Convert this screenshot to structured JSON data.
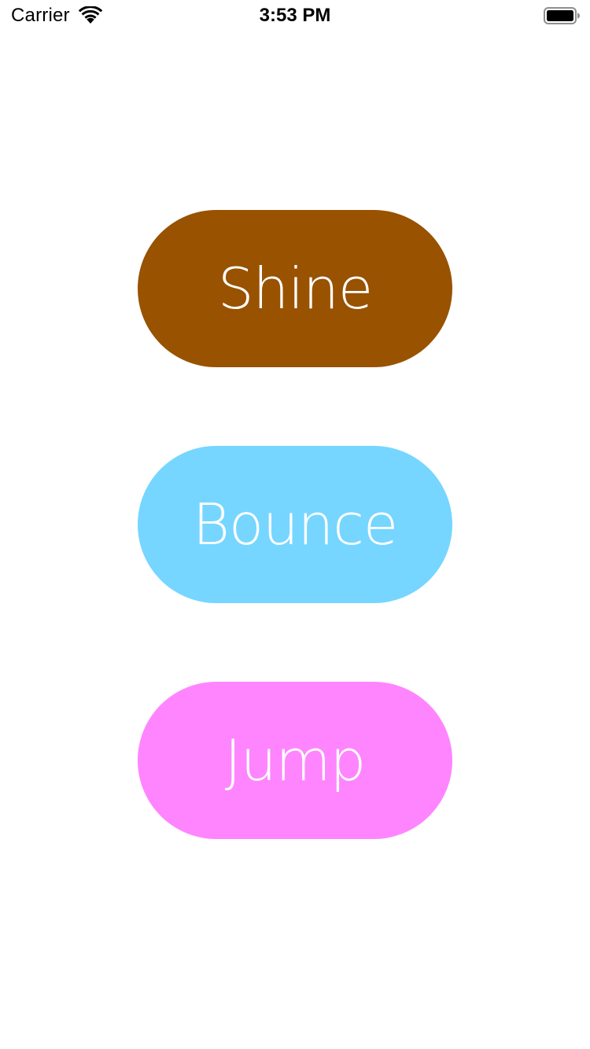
{
  "status_bar": {
    "carrier": "Carrier",
    "time": "3:53 PM",
    "wifi_icon": "wifi-icon",
    "battery_icon": "battery-icon"
  },
  "buttons": [
    {
      "label": "Shine",
      "color": "#985200"
    },
    {
      "label": "Bounce",
      "color": "#76D6FF"
    },
    {
      "label": "Jump",
      "color": "#FF85FF"
    }
  ]
}
